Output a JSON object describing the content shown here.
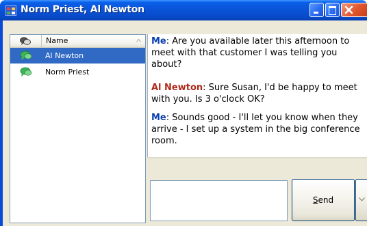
{
  "window": {
    "title": "Norm Priest, Al Newton"
  },
  "contacts": {
    "columns": [
      "",
      "Name"
    ],
    "items": [
      {
        "label": "Al Newton",
        "icon": "chat-bubble-icon",
        "selected": true
      },
      {
        "label": "Norm Priest",
        "icon": "chat-bubble-icon",
        "selected": false
      }
    ]
  },
  "conversation": [
    {
      "speaker": "Me",
      "separator": ":",
      "text": " Are you available later this afternoon to meet with that customer I was telling you about?"
    },
    {
      "speaker": "Al Newton",
      "separator": ":",
      "text": " Sure Susan, I'd be happy to meet with you. Is 3 o'clock OK?"
    },
    {
      "speaker": "Me",
      "separator": ":",
      "text": " Sounds good - I'll let you know when they arrive - I set up a system in the big conference room."
    }
  ],
  "compose": {
    "value": "",
    "send_label_prefix": "",
    "send_label_mnemonic": "S",
    "send_label_rest": "end"
  },
  "colors": {
    "title_bar": "#0a54d8",
    "selection": "#316ac5",
    "me_speaker": "#0a3fb0",
    "other_speaker": "#b02a1a"
  }
}
